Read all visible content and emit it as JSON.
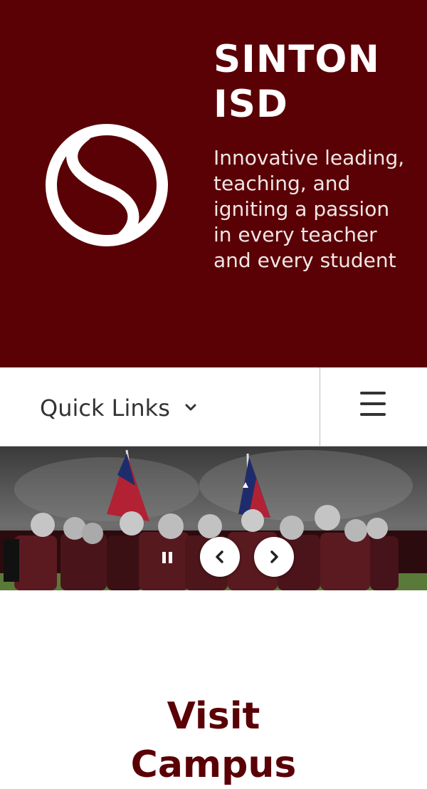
{
  "brand": {
    "title_line1": "SINTON",
    "title_line2": "ISD",
    "tagline": "Innovative leading, teaching, and igniting a passion in every teacher and every student",
    "primary_color": "#5a0106"
  },
  "nav": {
    "quick_links_label": "Quick Links",
    "dropdown_icon": "chevron-down-icon",
    "menu_icon": "hamburger-menu-icon"
  },
  "carousel": {
    "pause_icon": "pause-icon",
    "prev_icon": "chevron-left-icon",
    "next_icon": "chevron-right-icon"
  },
  "section": {
    "title_line1": "Visit",
    "title_line2": "Campus"
  }
}
